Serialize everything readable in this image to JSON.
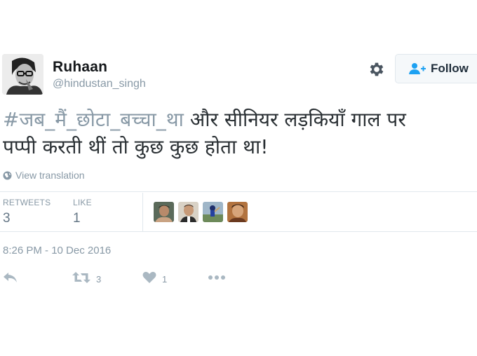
{
  "user": {
    "display_name": "Ruhaan",
    "handle": "@hindustan_singh"
  },
  "follow_button": {
    "label": "Follow"
  },
  "tweet": {
    "hashtag": "#जब_मैं_छोटा_बच्चा_था",
    "line1_rest": " और सीनियर लड़कियाँ गाल पर",
    "line2": "पप्पी करती थीं तो कुछ कुछ होता था!"
  },
  "translate": {
    "label": "View translation"
  },
  "stats": {
    "retweets_label": "RETWEETS",
    "retweets_value": "3",
    "likes_label": "LIKE",
    "likes_value": "1"
  },
  "timestamp": "8:26 PM - 10 Dec 2016",
  "actions": {
    "retweet_count": "3",
    "like_count": "1"
  },
  "icons": {
    "gear": "gear-icon",
    "follow": "user-plus-icon",
    "globe": "globe-icon",
    "reply": "reply-icon",
    "retweet": "retweet-icon",
    "like": "heart-icon",
    "more": "more-icon"
  },
  "colors": {
    "muted": "#8899a6",
    "text": "#292f33",
    "accent": "#1da1f2"
  }
}
